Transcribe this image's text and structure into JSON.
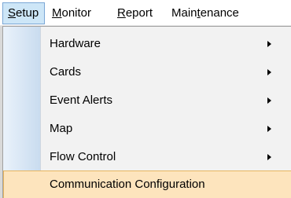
{
  "menubar": {
    "items": [
      {
        "pre": "",
        "ul": "S",
        "post": "etup",
        "active": true
      },
      {
        "pre": "",
        "ul": "M",
        "post": "onitor",
        "active": false
      },
      {
        "pre": "",
        "ul": "R",
        "post": "eport",
        "active": false
      },
      {
        "pre": "Main",
        "ul": "t",
        "post": "enance",
        "active": false
      }
    ]
  },
  "setup_menu": {
    "items": [
      {
        "label": "Hardware",
        "has_submenu": true
      },
      {
        "label": "Cards",
        "has_submenu": true
      },
      {
        "label": "Event Alerts",
        "has_submenu": true
      },
      {
        "label": "Map",
        "has_submenu": true
      },
      {
        "label": "Flow Control",
        "has_submenu": true
      },
      {
        "label": "Communication Configuration",
        "has_submenu": false,
        "highlighted": true
      }
    ]
  },
  "colors": {
    "highlight_bg": "#fde4bd",
    "highlight_border": "#e7b45e",
    "active_menu_bg": "#cde6f7",
    "menu_bg": "#f2f2f2"
  }
}
